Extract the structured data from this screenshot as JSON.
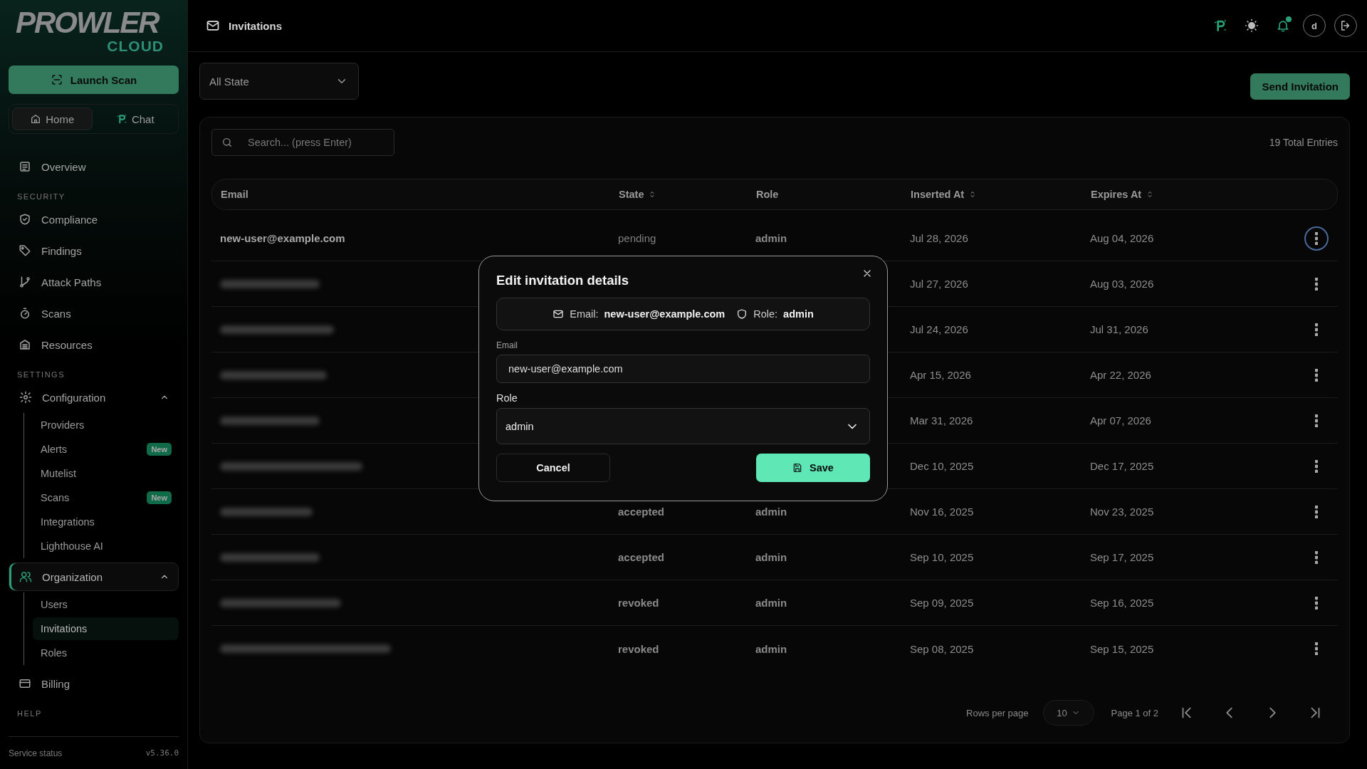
{
  "sidebar": {
    "logo": {
      "word": "PROWLER",
      "sub": "CLOUD"
    },
    "launch_button": "Launch Scan",
    "switcher": [
      {
        "label": "Home",
        "selected": true
      },
      {
        "label": "Chat",
        "selected": false
      }
    ],
    "nav": [
      {
        "kind": "link",
        "label": "Overview"
      },
      {
        "kind": "heading",
        "label": "SECURITY"
      },
      {
        "kind": "link",
        "label": "Compliance"
      },
      {
        "kind": "link",
        "label": "Findings"
      },
      {
        "kind": "link",
        "label": "Attack Paths"
      },
      {
        "kind": "link",
        "label": "Scans"
      },
      {
        "kind": "link",
        "label": "Resources"
      },
      {
        "kind": "heading",
        "label": "SETTINGS"
      },
      {
        "kind": "group",
        "label": "Configuration",
        "expanded": true,
        "selected": false,
        "children": [
          {
            "label": "Providers",
            "selected": false
          },
          {
            "label": "Alerts",
            "badge": "New",
            "selected": false
          },
          {
            "label": "Mutelist",
            "selected": false
          },
          {
            "label": "Scans",
            "badge": "New",
            "selected": false
          },
          {
            "label": "Integrations",
            "selected": false
          },
          {
            "label": "Lighthouse AI",
            "selected": false
          }
        ]
      },
      {
        "kind": "group",
        "label": "Organization",
        "expanded": true,
        "selected": true,
        "children": [
          {
            "label": "Users",
            "selected": false
          },
          {
            "label": "Invitations",
            "selected": true
          },
          {
            "label": "Roles",
            "selected": false
          }
        ]
      },
      {
        "kind": "link",
        "label": "Billing"
      },
      {
        "kind": "heading",
        "label": "HELP"
      }
    ],
    "footer": {
      "status": "Service status",
      "version": "v5.36.0"
    }
  },
  "topbar": {
    "title": "Invitations",
    "avatar": "d",
    "notification_dot": true
  },
  "filter": {
    "value": "All State"
  },
  "send_button": "Send Invitation",
  "search": {
    "placeholder": "Search... (press Enter)"
  },
  "total": "19 Total Entries",
  "table": {
    "columns": [
      {
        "label": "Email",
        "sortable": false
      },
      {
        "label": "State",
        "sortable": true
      },
      {
        "label": "Role",
        "sortable": false
      },
      {
        "label": "Inserted At",
        "sortable": true
      },
      {
        "label": "Expires At",
        "sortable": true
      }
    ],
    "rows": [
      {
        "email": "new-user@example.com",
        "state": "pending",
        "role": "admin",
        "inserted": "Jul 28, 2026",
        "expires": "Aug 04, 2026",
        "focused": true
      },
      {
        "email_blurred": true,
        "inserted": "Jul 27, 2026",
        "expires": "Aug 03, 2026",
        "focused": false
      },
      {
        "email_blurred": true,
        "inserted": "Jul 24, 2026",
        "expires": "Jul 31, 2026",
        "focused": false
      },
      {
        "email_blurred": true,
        "inserted": "Apr 15, 2026",
        "expires": "Apr 22, 2026",
        "focused": false
      },
      {
        "email_blurred": true,
        "inserted": "Mar 31, 2026",
        "expires": "Apr 07, 2026",
        "focused": false
      },
      {
        "email_blurred": true,
        "inserted": "Dec 10, 2025",
        "expires": "Dec 17, 2025",
        "focused": false
      },
      {
        "email_blurred": true,
        "state": "accepted",
        "role": "admin",
        "inserted": "Nov 16, 2025",
        "expires": "Nov 23, 2025",
        "focused": false
      },
      {
        "email_blurred": true,
        "state": "accepted",
        "role": "admin",
        "inserted": "Sep 10, 2025",
        "expires": "Sep 17, 2025",
        "focused": false
      },
      {
        "email_blurred": true,
        "state": "revoked",
        "role": "admin",
        "inserted": "Sep 09, 2025",
        "expires": "Sep 16, 2025",
        "focused": false
      },
      {
        "email_blurred": true,
        "state": "revoked",
        "role": "admin",
        "inserted": "Sep 08, 2025",
        "expires": "Sep 15, 2025",
        "focused": false
      }
    ]
  },
  "pagination": {
    "rows_label": "Rows per page",
    "rows_value": "10",
    "page_info": "Page 1 of 2"
  },
  "modal": {
    "title": "Edit invitation details",
    "summary": {
      "email_label": "Email:",
      "email": "new-user@example.com",
      "role_label": "Role:",
      "role": "admin"
    },
    "email_field": {
      "label": "Email",
      "value": "new-user@example.com"
    },
    "role_field": {
      "label": "Role",
      "value": "admin"
    },
    "cancel": "Cancel",
    "save": "Save"
  }
}
